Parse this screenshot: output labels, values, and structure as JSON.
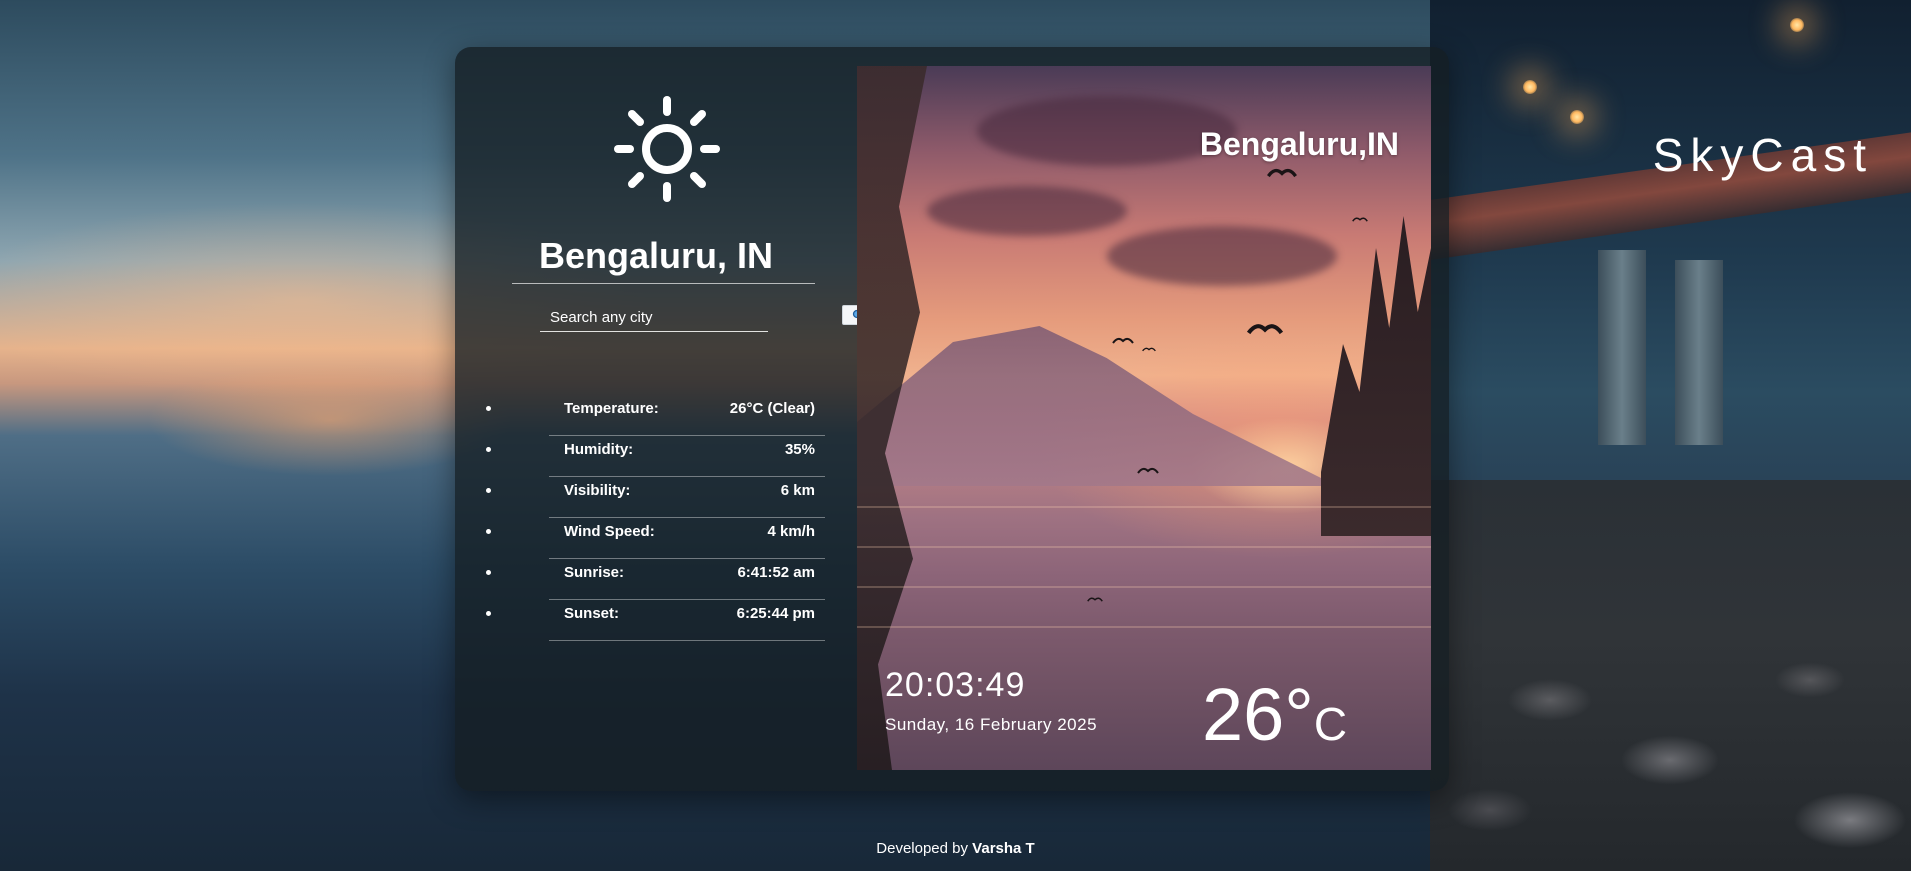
{
  "brand": {
    "name": "SkyCast"
  },
  "weather_card": {
    "city": "Bengaluru, IN",
    "search": {
      "placeholder": "Search any city",
      "value": ""
    },
    "condition_icon": "sun-icon",
    "stats": [
      {
        "label": "Temperature:",
        "value": "26°C (Clear)"
      },
      {
        "label": "Humidity:",
        "value": "35%"
      },
      {
        "label": "Visibility:",
        "value": "6 km"
      },
      {
        "label": "Wind Speed:",
        "value": "4 km/h"
      },
      {
        "label": "Sunrise:",
        "value": "6:41:52 am"
      },
      {
        "label": "Sunset:",
        "value": "6:25:44 pm"
      }
    ]
  },
  "scene": {
    "city": "Bengaluru,IN",
    "time": "20:03:49",
    "date": "Sunday, 16 February 2025",
    "temperature": "26°",
    "temperature_unit": "C"
  },
  "footer": {
    "prefix": "Developed by",
    "author": "Varsha T"
  },
  "colors": {
    "card_background": "#141e22",
    "text": "#ffffff",
    "search_button": "#f4f6f8"
  }
}
